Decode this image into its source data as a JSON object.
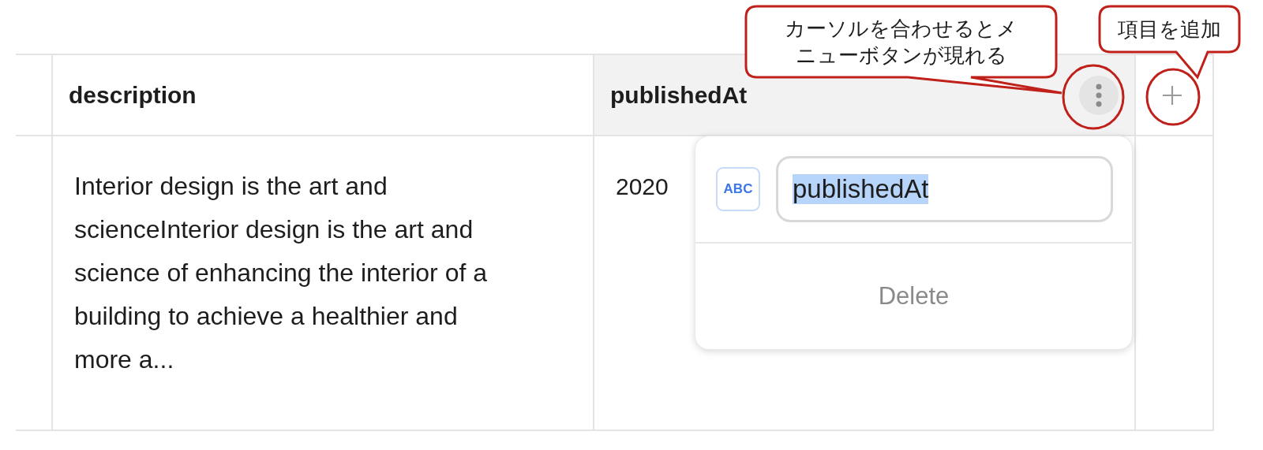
{
  "table": {
    "columns": [
      {
        "label": "description",
        "hovered": false
      },
      {
        "label": "publishedAt",
        "hovered": true
      }
    ],
    "rows": [
      {
        "cells": [
          "Interior design is the art and scienceInterior design is the art and science of enhancing the interior of a building to achieve a healthier and more a...",
          "2020"
        ]
      }
    ]
  },
  "column_menu": {
    "type_badge": "ABC",
    "field": {
      "value": "publishedAt",
      "selected_text": true
    },
    "delete_label": "Delete"
  },
  "annotations": [
    {
      "text": "カーソルを合わせるとメニューボタンが現れる"
    },
    {
      "text": "項目を追加"
    }
  ]
}
